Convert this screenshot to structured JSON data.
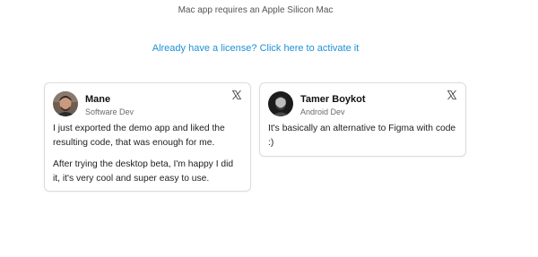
{
  "header": {
    "note": "Mac app requires an Apple Silicon Mac",
    "license_link": "Already have a license? Click here to activate it"
  },
  "colors": {
    "link": "#1e90d6",
    "card_border": "#dcdcdc"
  },
  "testimonials": [
    {
      "name": "Mane",
      "role": "Software Dev",
      "source_icon": "x-logo-icon",
      "paragraphs": [
        "I just exported the demo app and liked the resulting code, that was enough for me.",
        "After trying the desktop beta, I'm happy I did it, it's very cool and super easy to use."
      ]
    },
    {
      "name": "Tamer Boykot",
      "role": "Android Dev",
      "source_icon": "x-logo-icon",
      "paragraphs": [
        "It's basically an alternative to Figma with code :)"
      ]
    }
  ]
}
